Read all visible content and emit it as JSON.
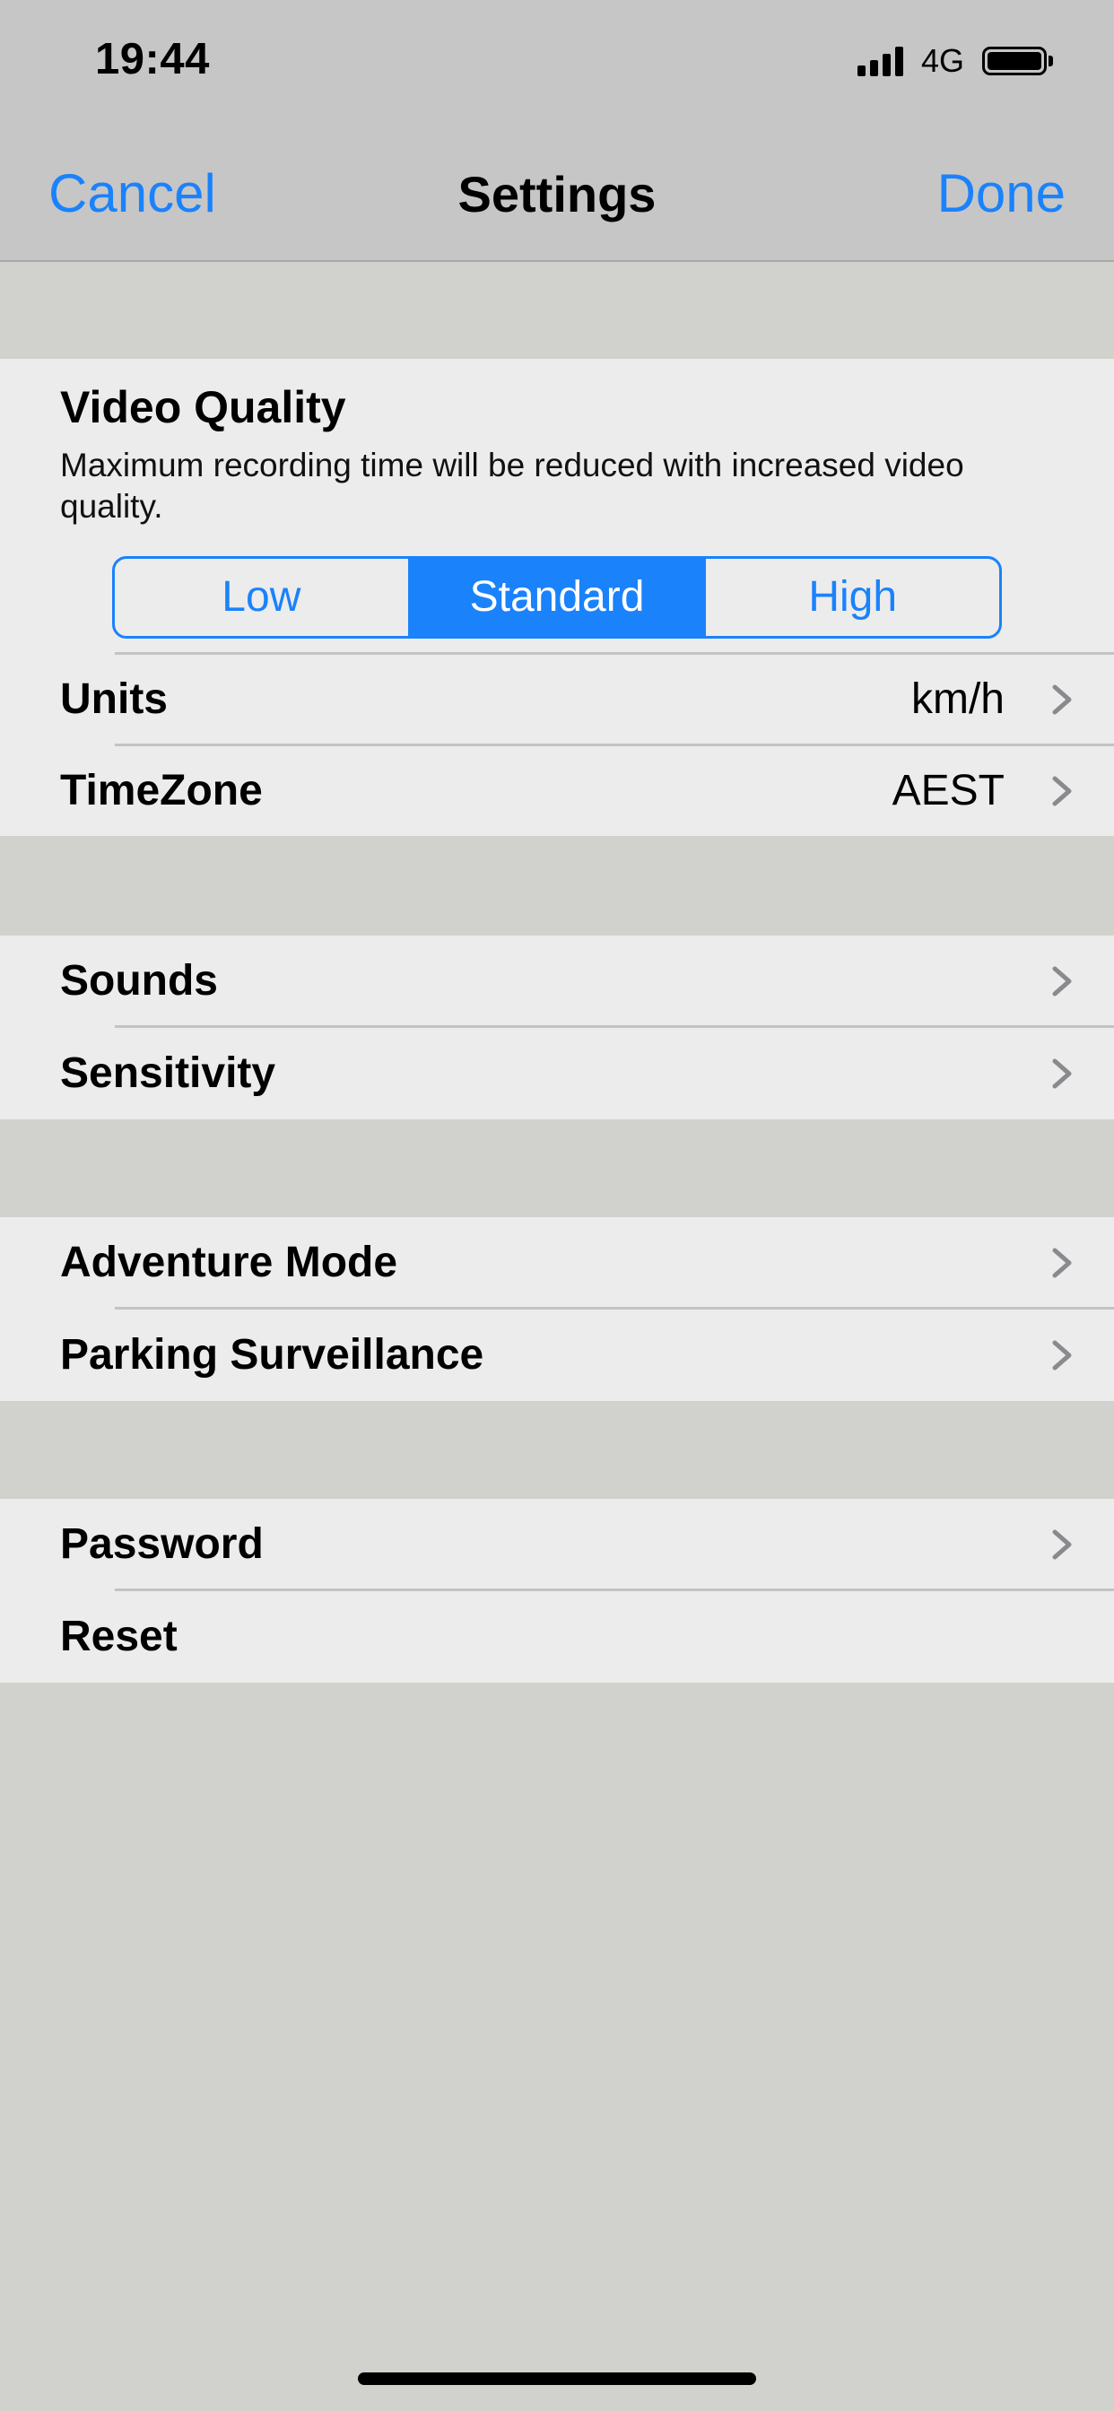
{
  "status_bar": {
    "time": "19:44",
    "network": "4G"
  },
  "nav": {
    "cancel_label": "Cancel",
    "title": "Settings",
    "done_label": "Done"
  },
  "video_quality": {
    "title": "Video Quality",
    "description": "Maximum recording time will be reduced with increased video quality.",
    "options": [
      "Low",
      "Standard",
      "High"
    ],
    "selected": "Standard"
  },
  "units": {
    "label": "Units",
    "value": "km/h"
  },
  "timezone": {
    "label": "TimeZone",
    "value": "AEST"
  },
  "sounds": {
    "label": "Sounds"
  },
  "sensitivity": {
    "label": "Sensitivity"
  },
  "adventure_mode": {
    "label": "Adventure Mode"
  },
  "parking_surveillance": {
    "label": "Parking Surveillance"
  },
  "password": {
    "label": "Password"
  },
  "reset": {
    "label": "Reset"
  },
  "colors": {
    "accent": "#1a82fb",
    "background": "#d1d1cd",
    "cell": "#ececec",
    "bar": "#c6c6c6"
  },
  "icons": [
    "signal-icon",
    "battery-icon",
    "chevron-right-icon"
  ]
}
